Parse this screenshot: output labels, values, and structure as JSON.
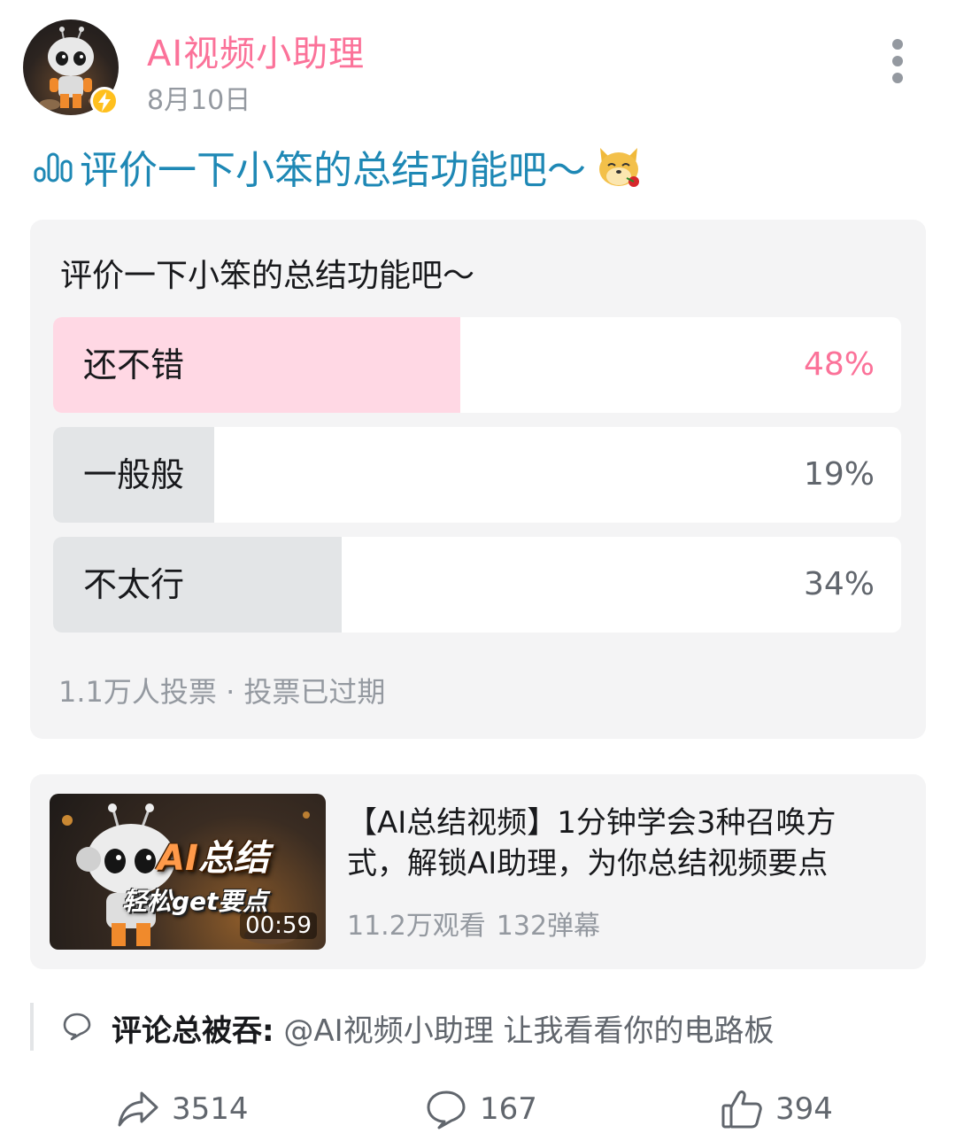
{
  "post": {
    "author": "AI视频小助理",
    "date": "8月10日",
    "title": "评价一下小笨的总结功能吧～"
  },
  "poll": {
    "question": "评价一下小笨的总结功能吧～",
    "options": [
      {
        "label": "还不错",
        "percent_text": "48%",
        "percent": 48,
        "selected": true
      },
      {
        "label": "一般般",
        "percent_text": "19%",
        "percent": 19,
        "selected": false
      },
      {
        "label": "不太行",
        "percent_text": "34%",
        "percent": 34,
        "selected": false
      }
    ],
    "meta": "1.1万人投票 · 投票已过期"
  },
  "video": {
    "thumb_title_line1_a": "AI",
    "thumb_title_line1_b": "总结",
    "thumb_title_line2": "轻松get要点",
    "duration": "00:59",
    "title": "【AI总结视频】1分钟学会3种召唤方式，解锁AI助理，为你总结视频要点",
    "views": "11.2万观看",
    "danmaku": "132弹幕"
  },
  "comment_preview": {
    "author": "评论总被吞:",
    "text": "@AI视频小助理 让我看看你的电路板"
  },
  "actions": {
    "share_count": "3514",
    "comment_count": "167",
    "like_count": "394"
  },
  "colors": {
    "brand_pink": "#fb7299",
    "title_blue": "#1e88b5",
    "selected_fill": "#ffd8e4",
    "unselected_fill": "#e3e5e7"
  },
  "icons": {
    "more": "more-vertical-icon",
    "verified": "lightning-badge-icon",
    "poll": "poll-bars-icon",
    "emoji": "doge-rose-emoji-icon",
    "comment_preview": "speech-bubble-icon",
    "share": "share-arrow-icon",
    "comment": "comment-icon",
    "like": "thumbs-up-icon"
  }
}
